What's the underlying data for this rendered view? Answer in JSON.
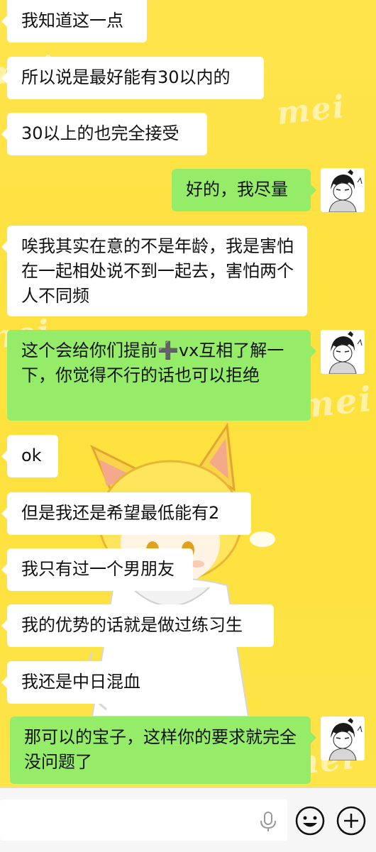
{
  "wallpaper": {
    "watermark": "mei"
  },
  "messages": [
    {
      "side": "in",
      "text": "我知道这一点"
    },
    {
      "side": "in",
      "text": "所以说是最好能有30以内的"
    },
    {
      "side": "in",
      "text": "30以上的也完全接受"
    },
    {
      "side": "out",
      "text": "好的，我尽量"
    },
    {
      "side": "in",
      "text": "唉我其实在意的不是年龄，我是害怕在一起相处说不到一起去，害怕两个人不同频"
    },
    {
      "side": "out",
      "text": "这个会给你们提前➕vx互相了解一下，你觉得不行的话也可以拒绝"
    },
    {
      "side": "in",
      "text": "ok"
    },
    {
      "side": "in",
      "text": "但是我还是希望最低能有2"
    },
    {
      "side": "in",
      "text": "我只有过一个男朋友"
    },
    {
      "side": "in",
      "text": "我的优势的话就是做过练习生"
    },
    {
      "side": "in",
      "text": "我还是中日混血"
    },
    {
      "side": "out",
      "text": "那可以的宝子，这样你的要求就完全没问题了"
    }
  ],
  "input_bar": {
    "icons": [
      "microphone-icon",
      "emoji-icon",
      "plus-icon"
    ]
  },
  "colors": {
    "incoming_bubble": "#ffffff",
    "outgoing_bubble": "#95ec69",
    "wallpaper": "#fde13c"
  }
}
